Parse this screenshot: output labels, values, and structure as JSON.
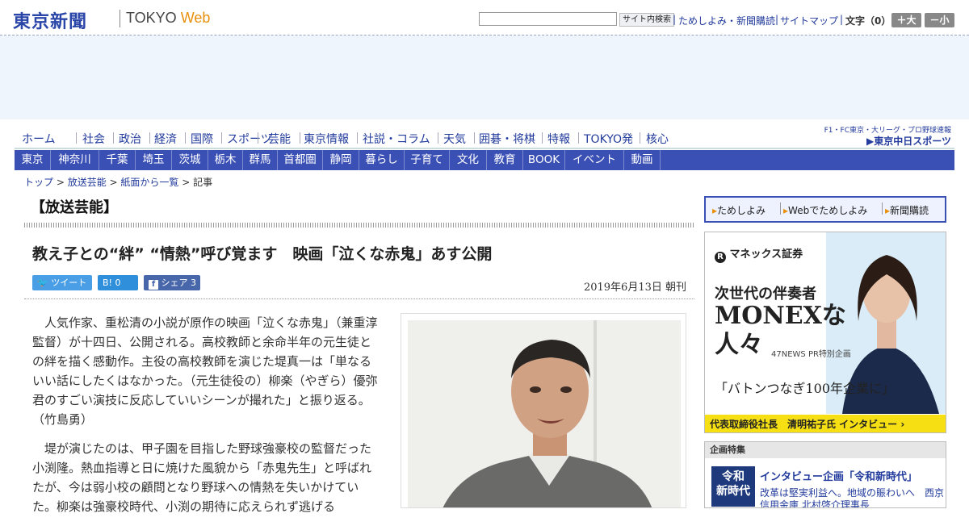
{
  "header": {
    "logo_jp": "東京新聞",
    "logo_tokyo": "TOKYO",
    "logo_web": "Web",
    "search_button": "サイト内検索",
    "links": [
      "ためしよみ・新聞購読",
      "サイトマップ"
    ],
    "font_size_label": "文字（0）",
    "font_up": "＋大",
    "font_down": "－小"
  },
  "nav_main": [
    "ホーム",
    "社会",
    "政治",
    "経済",
    "国際",
    "スポーツ",
    "芸能",
    "東京情報",
    "社説・コラム",
    "天気",
    "囲碁・将棋",
    "特報",
    "TOKYO発",
    "核心"
  ],
  "chunichi": {
    "top": "F1・FC東京・大リーグ・プロ野球速報",
    "brand": "▶東京中日スポーツ"
  },
  "nav_region": [
    "東京",
    "神奈川",
    "千葉",
    "埼玉",
    "茨城",
    "栃木",
    "群馬",
    "首都圏",
    "静岡",
    "暮らし",
    "子育て",
    "文化",
    "教育",
    "BOOK",
    "イベント",
    "動画"
  ],
  "breadcrumb": {
    "items": [
      "トップ",
      "放送芸能",
      "紙面から一覧"
    ],
    "current": "記事",
    "sep": " > "
  },
  "article": {
    "section": "【放送芸能】",
    "headline": "教え子との“絆” “情熱”呼び覚ます　映画「泣くな赤鬼」あす公開",
    "tweet": "ツイート",
    "hatena": "B! 0",
    "facebook": "シェア 3",
    "date": "2019年6月13日 朝刊",
    "paragraphs": [
      "人気作家、重松清の小説が原作の映画「泣くな赤鬼」（兼重淳監督）が十四日、公開される。高校教師と余命半年の元生徒との絆を描く感動作。主役の高校教師を演じた堤真一は「単なるいい話にしたくはなかった。（元生徒役の）柳楽（やぎら）優弥君のすごい演技に反応していいシーンが撮れた」と振り返る。　（竹島勇）",
      "堤が演じたのは、甲子園を目指した野球強豪校の監督だった小渕隆。熱血指導と日に焼けた風貌から「赤鬼先生」と呼ばれたが、今は弱小校の顧問となり野球への情熱を失いかけていた。柳楽は強豪校時代、小渕の期待に応えられず逃げる"
    ]
  },
  "sidebar": {
    "promo": [
      "ためしよみ",
      "Webでためしよみ",
      "新聞購読"
    ],
    "monex": {
      "logo": "マネックス証券",
      "tagline": "次世代の伴奏者",
      "big1": "MONEXな",
      "big2": "人々",
      "tag47": "47NEWS PR特別企画",
      "sub": "「バトンつなぎ100年企業に」",
      "foot": "代表取締役社長　清明祐子氏 インタビュー ›"
    },
    "kikaku": {
      "heading": "企画特集",
      "thumb1": "令和",
      "thumb2": "新時代",
      "title": "インタビュー企画「令和新時代」",
      "desc": "改革は堅実利益へ。地域の賑わいへ　西京信用金庫 北村啓介理事長"
    }
  }
}
